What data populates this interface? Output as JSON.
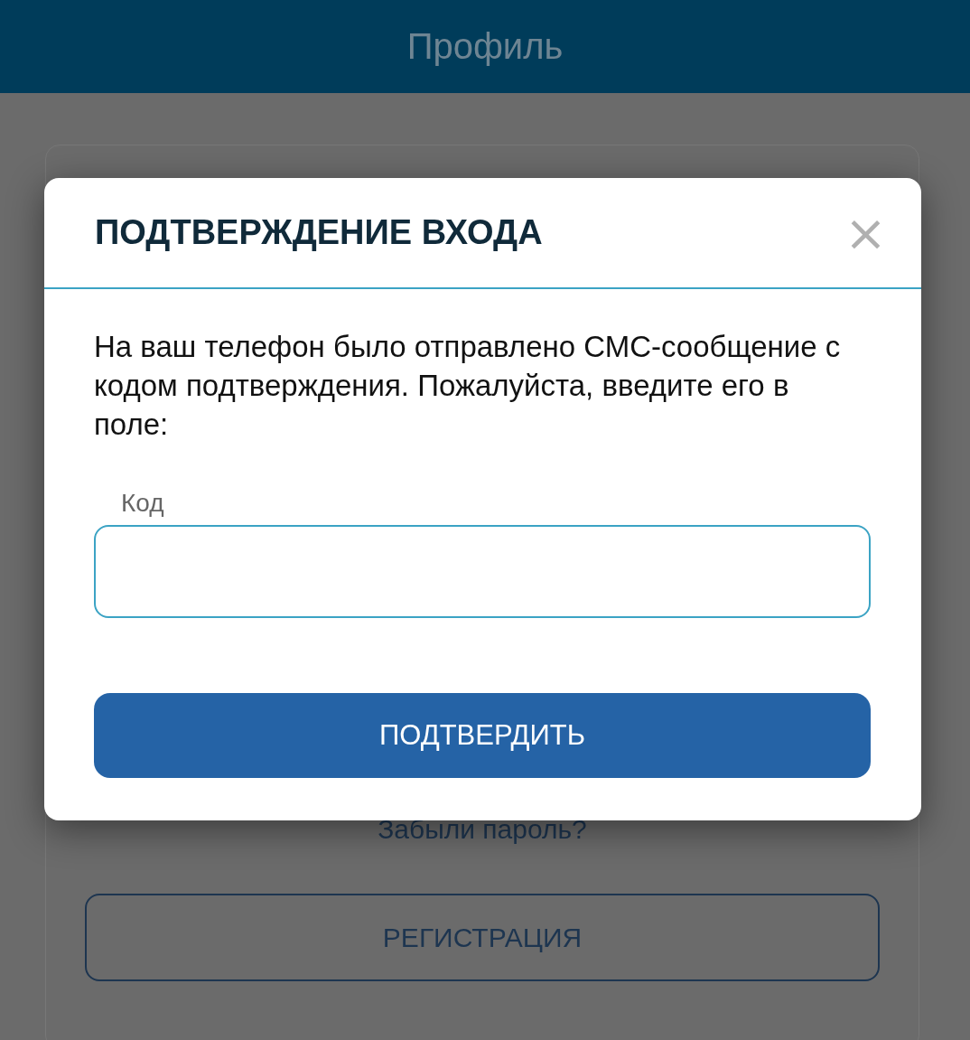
{
  "header": {
    "title": "Профиль"
  },
  "background_form": {
    "forgot_link": "Забыли пароль?",
    "register_button": "РЕГИСТРАЦИЯ"
  },
  "dialog": {
    "title": "ПОДТВЕРЖДЕНИЕ ВХОДА",
    "close": "×",
    "message": "На ваш телефон было отправлено СМС-сообщение с кодом подтверждения. Пожалуйста, введите его в поле:",
    "code_field": {
      "label": "Код"
    },
    "confirm_button": "ПОДТВЕРДИТЬ"
  }
}
